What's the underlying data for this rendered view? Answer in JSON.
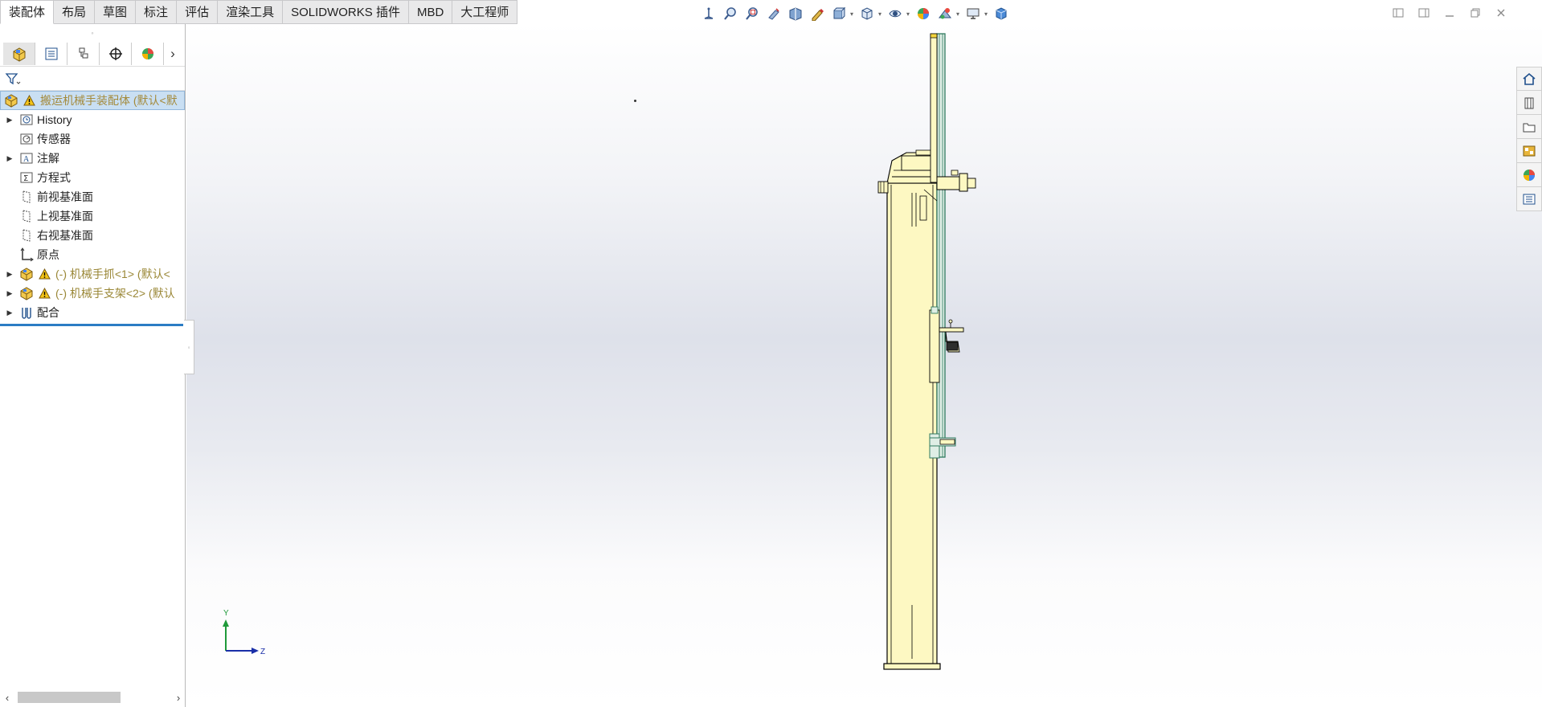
{
  "command_tabs": [
    {
      "label": "装配体",
      "active": true
    },
    {
      "label": "布局"
    },
    {
      "label": "草图"
    },
    {
      "label": "标注"
    },
    {
      "label": "评估"
    },
    {
      "label": "渲染工具"
    },
    {
      "label": "SOLIDWORKS 插件"
    },
    {
      "label": "MBD"
    },
    {
      "label": "大工程师"
    }
  ],
  "view_toolbar_icons": [
    "view-orientation-icon",
    "zoom-to-fit-icon",
    "zoom-to-area-icon",
    "previous-view-icon",
    "section-view-icon",
    "dynamic-annotation-icon",
    "view-selector-icon",
    "view-orientation-cube-icon",
    "display-style-icon",
    "hide-show-icon",
    "edit-appearance-icon",
    "apply-scene-icon",
    "view-settings-icon",
    "3d-view-icon"
  ],
  "feature_manager": {
    "tabs": [
      "feature-tree",
      "property-manager",
      "configuration-manager",
      "dimxpert-manager",
      "display-manager"
    ],
    "root": {
      "label": "搬运机械手装配体 (默认<默"
    },
    "nodes": [
      {
        "label": "History",
        "icon": "history-icon",
        "expandable": true
      },
      {
        "label": "传感器",
        "icon": "sensor-icon",
        "expandable": false
      },
      {
        "label": "注解",
        "icon": "annotation-icon",
        "expandable": true
      },
      {
        "label": "方程式",
        "icon": "equation-icon",
        "expandable": false
      },
      {
        "label": "前视基准面",
        "icon": "plane-icon",
        "expandable": false
      },
      {
        "label": "上视基准面",
        "icon": "plane-icon",
        "expandable": false
      },
      {
        "label": "右视基准面",
        "icon": "plane-icon",
        "expandable": false
      },
      {
        "label": "原点",
        "icon": "origin-icon",
        "expandable": false
      },
      {
        "label": "(-) 机械手抓<1> (默认<",
        "icon": "part-icon",
        "expandable": true,
        "warning": true
      },
      {
        "label": "(-) 机械手支架<2> (默认",
        "icon": "part-icon",
        "expandable": true,
        "warning": true
      },
      {
        "label": "配合",
        "icon": "mate-icon",
        "expandable": true
      }
    ]
  },
  "triad": {
    "y_label": "Y",
    "z_label": "Z"
  },
  "colors": {
    "part_fill": "#fdf8c2",
    "part_edge": "#000000",
    "rail_green": "#2f7a5f",
    "root_selected": "#c9dff3"
  }
}
